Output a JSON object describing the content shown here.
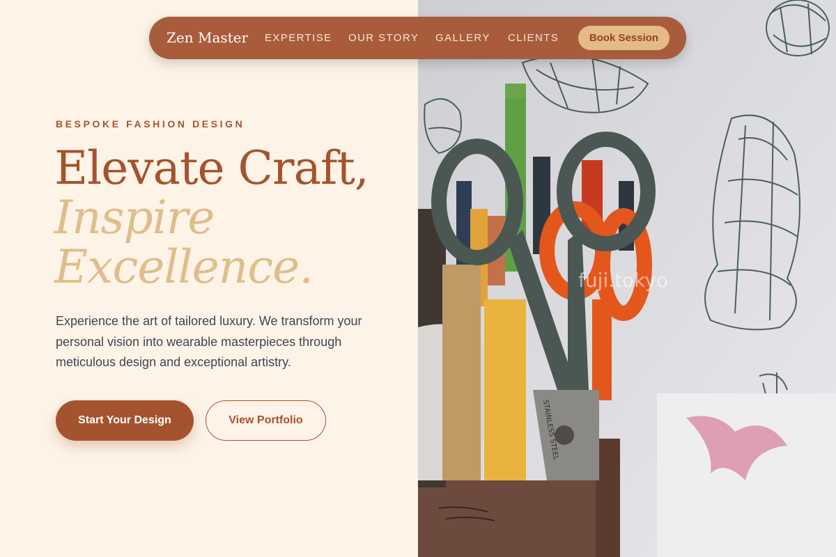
{
  "nav": {
    "brand": "Zen Master",
    "links": [
      "EXPERTISE",
      "OUR STORY",
      "GALLERY",
      "CLIENTS"
    ],
    "cta": "Book Session"
  },
  "hero": {
    "eyebrow": "BESPOKE FASHION DESIGN",
    "headline_line1": "Elevate Craft,",
    "headline_line2": "Inspire",
    "headline_line3": "Excellence.",
    "description": "Experience the art of tailored luxury. We transform your personal vision into wearable masterpieces through meticulous design and exceptional artistry.",
    "primary_button": "Start Your Design",
    "secondary_button": "View Portfolio"
  },
  "photo": {
    "watermark": "fuji.tokyo",
    "scissors_text": "STAINLESS STEEL"
  },
  "colors": {
    "accent": "#a4532f",
    "accent_light": "#dfbd8c",
    "background": "#fdf4e7",
    "nav_bg": "#a85c3c",
    "cta_bg": "#e4bb86"
  }
}
